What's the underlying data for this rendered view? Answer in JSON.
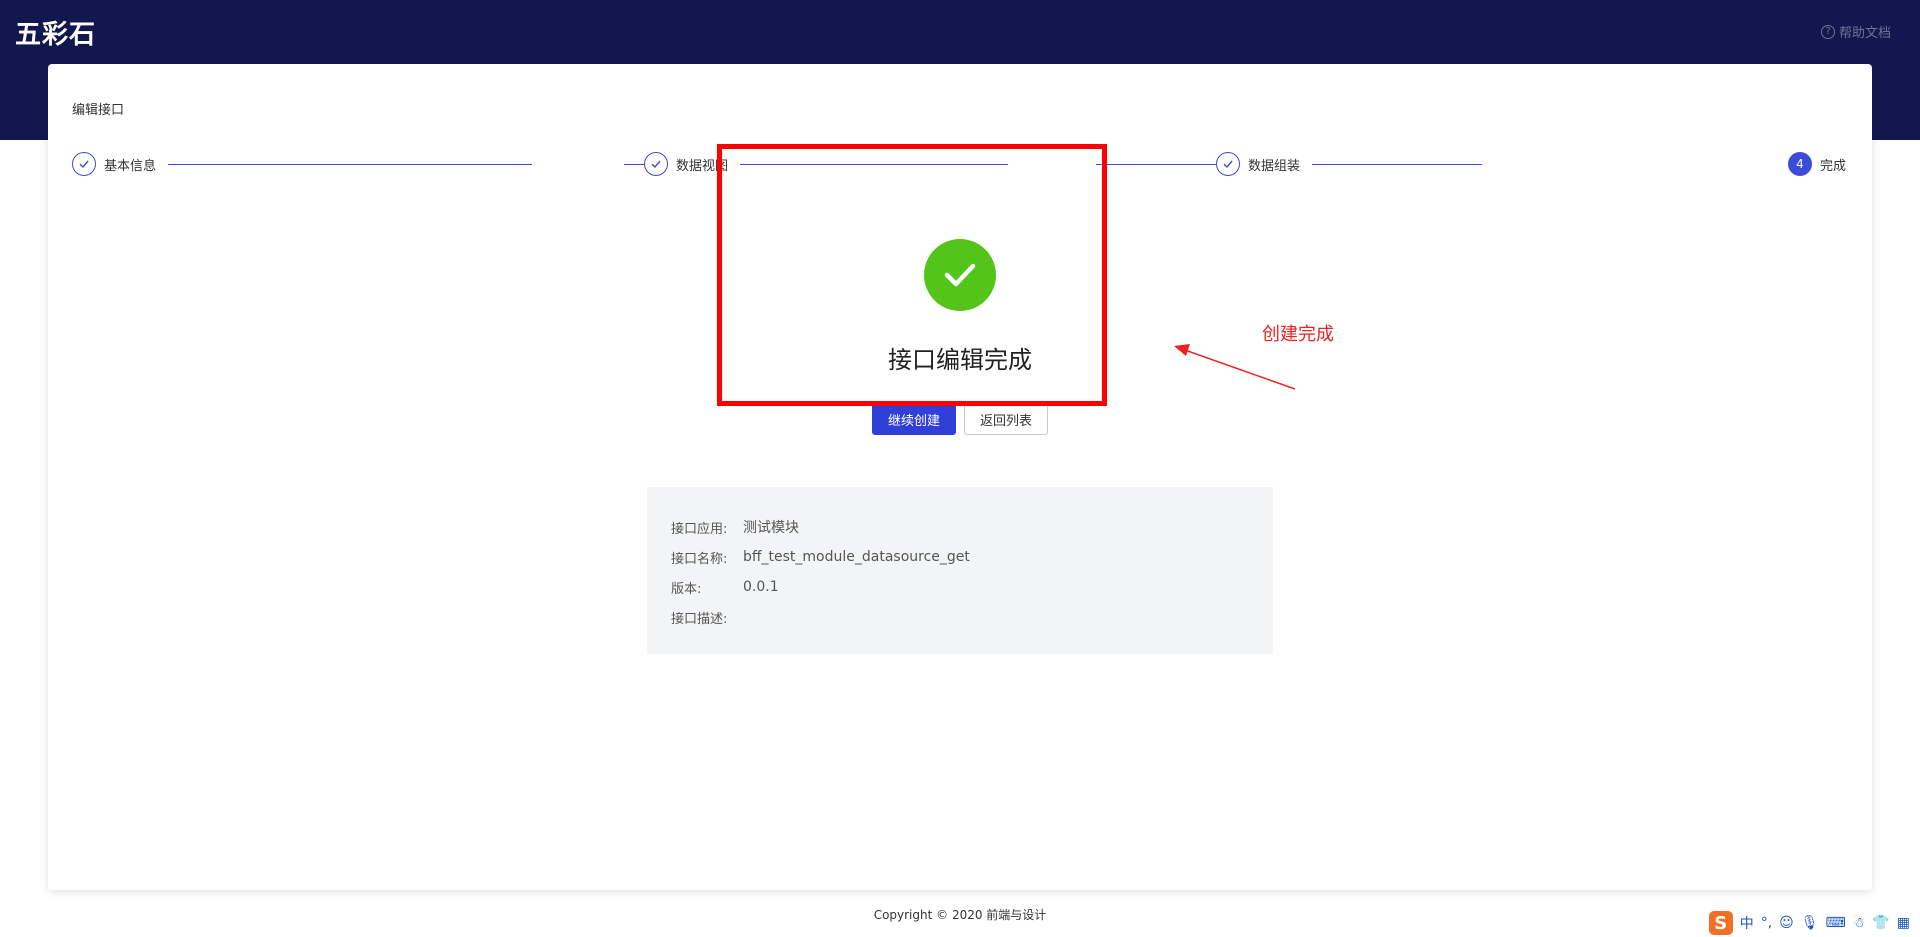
{
  "header": {
    "logo": "五彩石",
    "help_label": "帮助文档",
    "help_icon": "question-circle-icon"
  },
  "card": {
    "title": "编辑接口"
  },
  "steps": [
    {
      "label": "基本信息",
      "status": "finished"
    },
    {
      "label": "数据视图",
      "status": "finished"
    },
    {
      "label": "数据组装",
      "status": "finished"
    },
    {
      "label": "完成",
      "status": "active",
      "number": "4"
    }
  ],
  "result": {
    "title": "接口编辑完成",
    "primary_button": "继续创建",
    "secondary_button": "返回列表",
    "icon": "check-circle-icon",
    "icon_color": "#52c41a"
  },
  "annotation": {
    "text": "创建完成",
    "color": "#ee2222"
  },
  "info": {
    "rows": [
      {
        "label": "接口应用:",
        "value": "测试模块"
      },
      {
        "label": "接口名称:",
        "value": "bff_test_module_datasource_get"
      },
      {
        "label": "版本:",
        "value": "0.0.1"
      },
      {
        "label": "接口描述:",
        "value": ""
      }
    ]
  },
  "footer": {
    "copyright": "Copyright © 2020 前端与设计"
  },
  "ime": {
    "logo": "S",
    "lang": "中",
    "punct": "°,"
  },
  "colors": {
    "header_bg": "#12174f",
    "accent": "#2f3fd8",
    "success": "#52c41a"
  }
}
